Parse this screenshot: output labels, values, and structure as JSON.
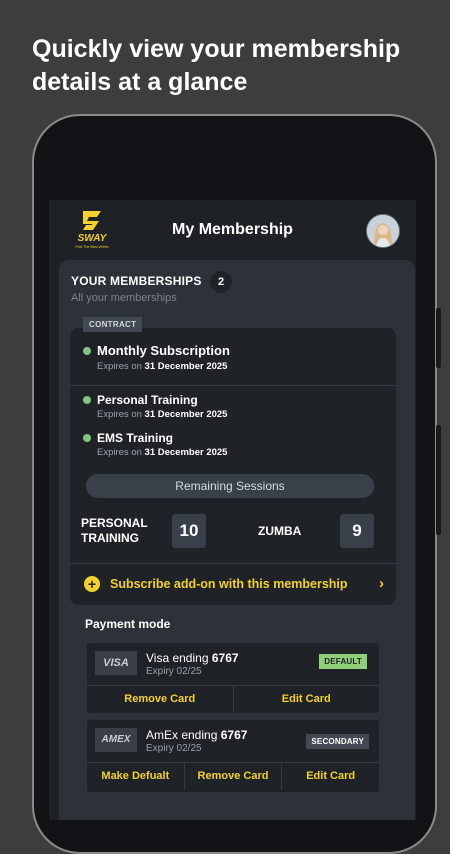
{
  "headline": "Quickly view your membership details at a glance",
  "colors": {
    "accent": "#f3d12b",
    "active_dot": "#7fc780",
    "default_badge": "#8fcf7a",
    "background": "#3d3d3d"
  },
  "app": {
    "logo_text": "SWAY",
    "logo_tagline": "Feel The Best Within",
    "title": "My Membership",
    "avatar_icon": "user-avatar"
  },
  "memberships": {
    "heading": "YOUR MEMBERSHIPS",
    "count": "2",
    "subtitle": "All your memberships",
    "tag": "CONTRACT",
    "plans": [
      {
        "name": "Monthly Subscription",
        "expires_prefix": "Expires on",
        "expires_date": "31 December 2025"
      },
      {
        "name": "Personal Training",
        "expires_prefix": "Expires on",
        "expires_date": "31 December 2025"
      },
      {
        "name": "EMS Training",
        "expires_prefix": "Expires on",
        "expires_date": "31 December 2025"
      }
    ],
    "remaining_label": "Remaining Sessions",
    "sessions": [
      {
        "label": "PERSONAL TRAINING",
        "value": "10"
      },
      {
        "label": "ZUMBA",
        "value": "9"
      }
    ],
    "addon_label": "Subscribe add-on with this membership"
  },
  "payment": {
    "title": "Payment mode",
    "cards": [
      {
        "brand": "VISA",
        "name_prefix": "Visa ending",
        "last4": "6767",
        "expiry": "Expiry 02/25",
        "badge": "DEFAULT",
        "actions": [
          "Remove Card",
          "Edit Card"
        ]
      },
      {
        "brand": "AMEX",
        "name_prefix": "AmEx ending",
        "last4": "6767",
        "expiry": "Expiry 02/25",
        "badge": "SECONDARY",
        "actions": [
          "Make Defualt",
          "Remove Card",
          "Edit Card"
        ]
      }
    ]
  }
}
